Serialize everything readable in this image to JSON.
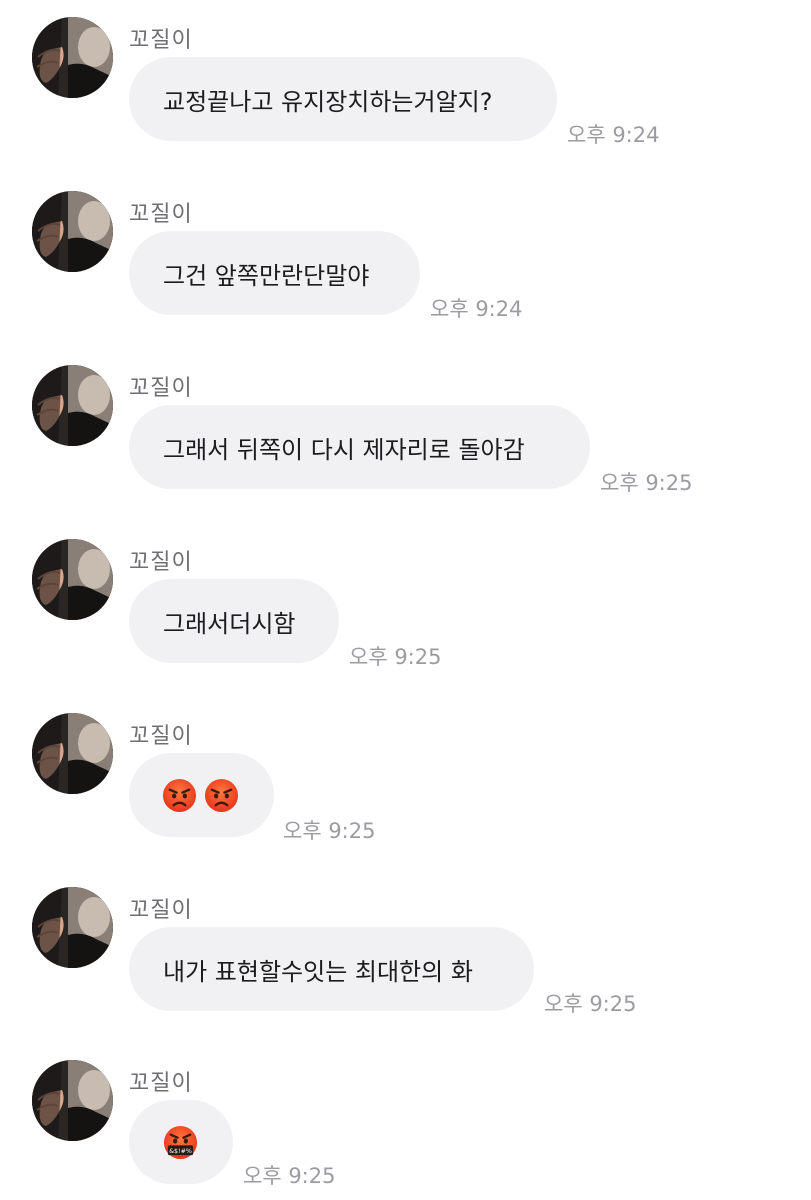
{
  "messages": [
    {
      "sender": "꼬질이",
      "text": "교정끝나고 유지장치하는거알지?",
      "time": "오후 9:24"
    },
    {
      "sender": "꼬질이",
      "text": "그건 앞쪽만란단말야",
      "time": "오후 9:24"
    },
    {
      "sender": "꼬질이",
      "text": "그래서 뒤쪽이 다시 제자리로 돌아감",
      "time": "오후 9:25"
    },
    {
      "sender": "꼬질이",
      "text": "그래서더시함",
      "time": "오후 9:25"
    },
    {
      "sender": "꼬질이",
      "emojis": [
        "pouting-face",
        "pouting-face"
      ],
      "time": "오후 9:25"
    },
    {
      "sender": "꼬질이",
      "text": "내가 표현할수잇는 최대한의 화",
      "time": "오후 9:25"
    },
    {
      "sender": "꼬질이",
      "emojis": [
        "face-with-symbols-on-mouth"
      ],
      "emoji_caption": "&$!#%",
      "time": "오후 9:25"
    }
  ],
  "colors": {
    "bubble": "#f1f1f4",
    "text": "#1c1c1e",
    "sender": "#6e6e73",
    "time": "#9b9ba1",
    "background": "#ffffff"
  }
}
